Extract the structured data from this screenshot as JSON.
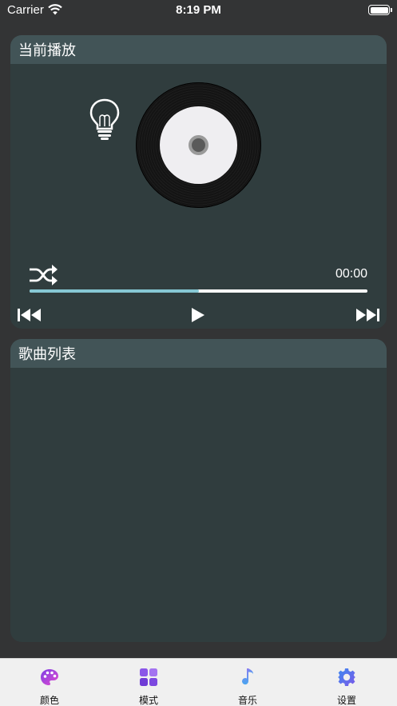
{
  "status_bar": {
    "carrier": "Carrier",
    "time": "8:19 PM"
  },
  "now_playing": {
    "title": "当前播放",
    "elapsed": "00:00",
    "progress_fraction": 0.5
  },
  "song_list": {
    "title": "歌曲列表"
  },
  "tab_bar": {
    "items": [
      {
        "label": "颜色",
        "icon": "palette-icon"
      },
      {
        "label": "模式",
        "icon": "grid-icon"
      },
      {
        "label": "音乐",
        "icon": "music-note-icon"
      },
      {
        "label": "设置",
        "icon": "gear-icon"
      }
    ]
  },
  "colors": {
    "background": "#333435",
    "card": "#303d3e",
    "card_header": "#425457",
    "progress": "#86c8d4"
  }
}
